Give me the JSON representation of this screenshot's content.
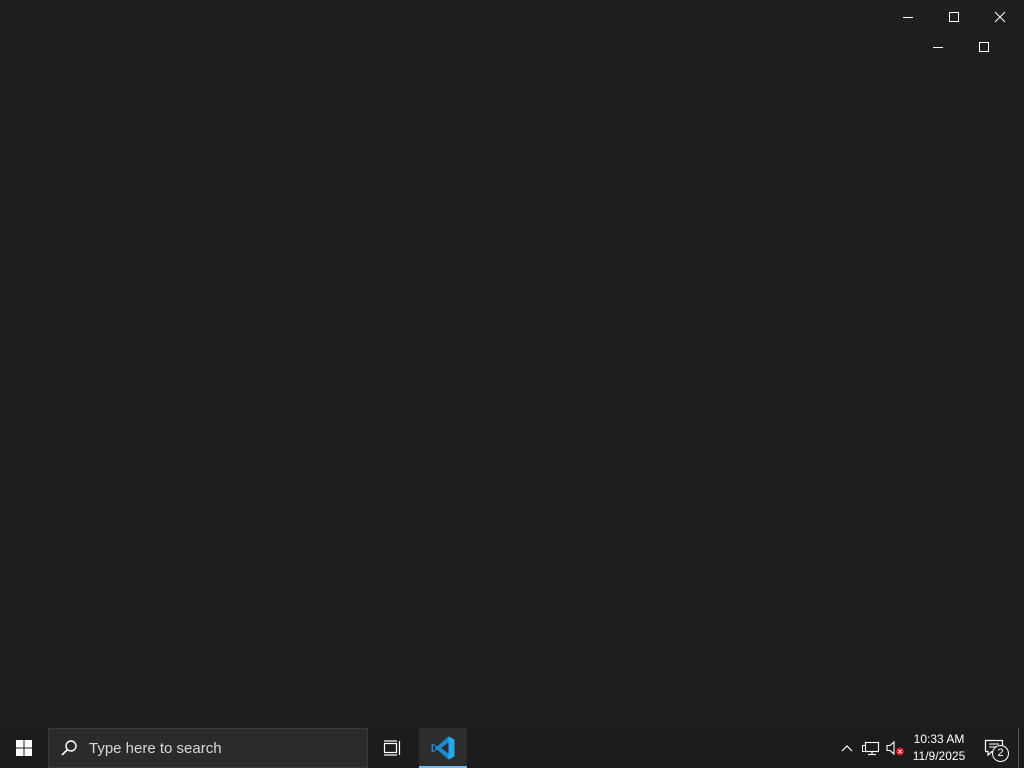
{
  "taskbar": {
    "search_placeholder": "Type here to search",
    "clock_time": "10:33 AM",
    "clock_date": "11/9/2025",
    "notification_count": "2",
    "pinned_apps": [
      "vscode-icon"
    ]
  },
  "window_controls": {
    "outer": [
      "minimize",
      "maximize",
      "close"
    ],
    "inner": [
      "minimize",
      "maximize"
    ]
  },
  "colors": {
    "desktop_bg": "#1f1f1f",
    "taskbar_bg": "#1c1c1c",
    "vscode_blue": "#23a9f2",
    "active_indicator": "#76b9ed",
    "mute_badge": "#e81123"
  }
}
